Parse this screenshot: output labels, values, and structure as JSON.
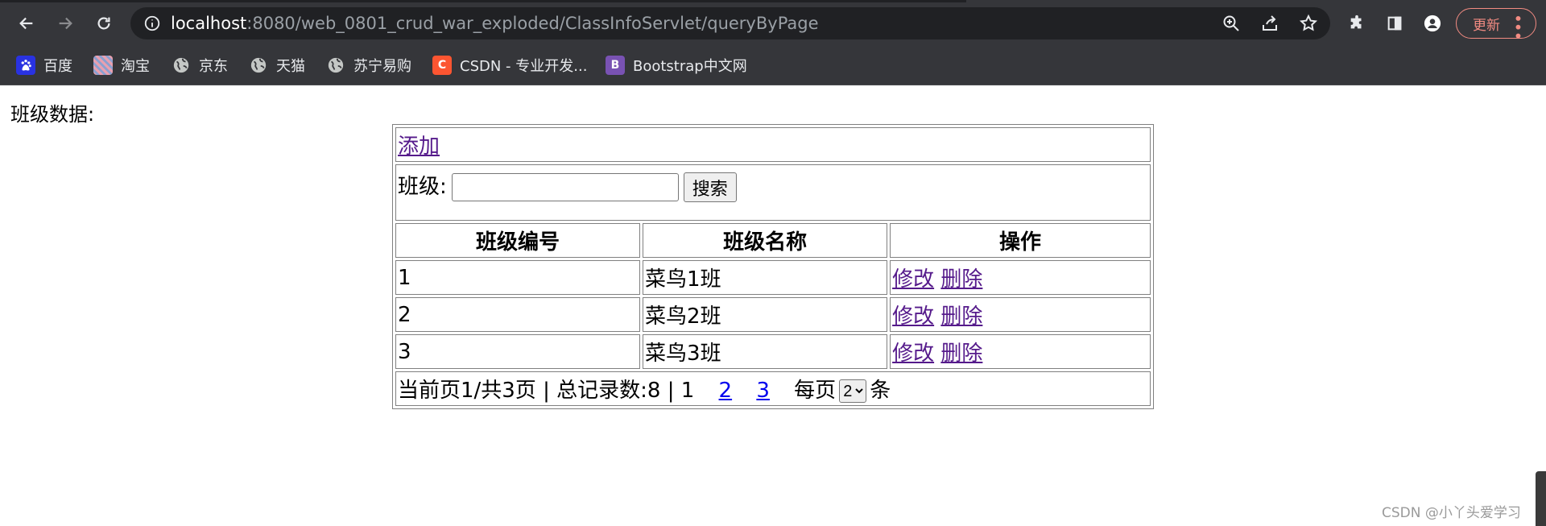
{
  "browser": {
    "url_host": "localhost",
    "url_rest": ":8080/web_0801_crud_war_exploded/ClassInfoServlet/queryByPage",
    "update_label": "更新",
    "bookmarks": [
      {
        "label": "百度",
        "icon": "baidu-icon"
      },
      {
        "label": "淘宝",
        "icon": "taobao-icon"
      },
      {
        "label": "京东",
        "icon": "globe-icon"
      },
      {
        "label": "天猫",
        "icon": "globe-icon"
      },
      {
        "label": "苏宁易购",
        "icon": "globe-icon"
      },
      {
        "label": "CSDN - 专业开发...",
        "icon": "csdn-icon",
        "glyph": "C"
      },
      {
        "label": "Bootstrap中文网",
        "icon": "bootstrap-icon",
        "glyph": "B"
      }
    ]
  },
  "page": {
    "title": "班级数据:",
    "add_link": "添加",
    "search": {
      "label": "班级:",
      "value": "",
      "button": "搜索"
    },
    "table": {
      "headers": [
        "班级编号",
        "班级名称",
        "操作"
      ],
      "rows": [
        {
          "id": "1",
          "name": "菜鸟1班",
          "edit": "修改",
          "delete": "删除"
        },
        {
          "id": "2",
          "name": "菜鸟2班",
          "edit": "修改",
          "delete": "删除"
        },
        {
          "id": "3",
          "name": "菜鸟3班",
          "edit": "修改",
          "delete": "删除"
        }
      ]
    },
    "pager": {
      "summary": "当前页1/共3页 | 总记录数:8 |",
      "current_page": "1",
      "page_links": [
        "2",
        "3"
      ],
      "per_page_label": "每页",
      "per_page_value": "2",
      "per_page_unit": "条"
    }
  },
  "watermark": "CSDN @小丫头爱学习",
  "colors": {
    "toolbar_bg": "#35363a",
    "omnibox_bg": "#202124",
    "update_accent": "#f28b82",
    "visited_link": "#551a8b",
    "unvisited_link": "#0000ee"
  }
}
